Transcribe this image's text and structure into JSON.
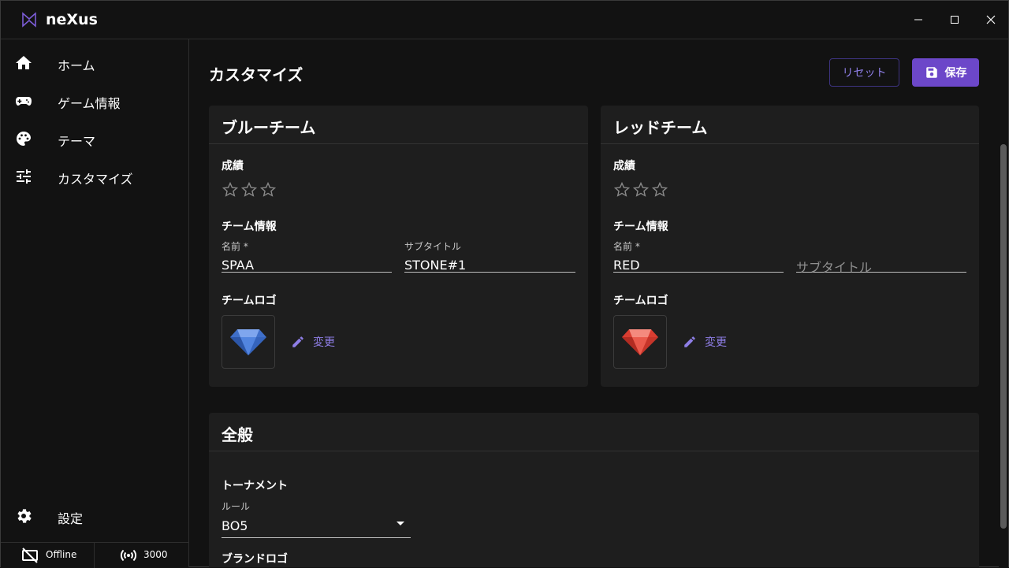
{
  "app": {
    "title": "neXus"
  },
  "sidebar": {
    "items": [
      {
        "label": "ホーム",
        "icon": "home-icon"
      },
      {
        "label": "ゲーム情報",
        "icon": "gamepad-icon"
      },
      {
        "label": "テーマ",
        "icon": "palette-icon"
      },
      {
        "label": "カスタマイズ",
        "icon": "tune-icon"
      }
    ],
    "settings": {
      "label": "設定",
      "icon": "gear-icon"
    },
    "status": {
      "connection": "Offline",
      "port": "3000"
    }
  },
  "main": {
    "title": "カスタマイズ",
    "reset_label": "リセット",
    "save_label": "保存",
    "blue_team": {
      "title": "ブルーチーム",
      "record_label": "成績",
      "stars_filled": 0,
      "stars_total": 3,
      "info_label": "チーム情報",
      "name_label": "名前 *",
      "name_value": "SPAA",
      "subtitle_label": "サブタイトル",
      "subtitle_value": "STONE#1",
      "logo_label": "チームロゴ",
      "change_label": "変更",
      "logo_color": "#4a7fd6"
    },
    "red_team": {
      "title": "レッドチーム",
      "record_label": "成績",
      "stars_filled": 0,
      "stars_total": 3,
      "info_label": "チーム情報",
      "name_label": "名前 *",
      "name_value": "RED",
      "subtitle_placeholder": "サブタイトル",
      "logo_label": "チームロゴ",
      "change_label": "変更",
      "logo_color": "#e0473a"
    },
    "general": {
      "title": "全般",
      "tournament_label": "トーナメント",
      "rule_label": "ルール",
      "rule_value": "BO5",
      "brand_logo_label": "ブランドロゴ"
    }
  },
  "colors": {
    "accent": "#6c47c9",
    "accent_text": "#8e7ee6",
    "card": "#1e1e1e",
    "background": "#121212"
  }
}
